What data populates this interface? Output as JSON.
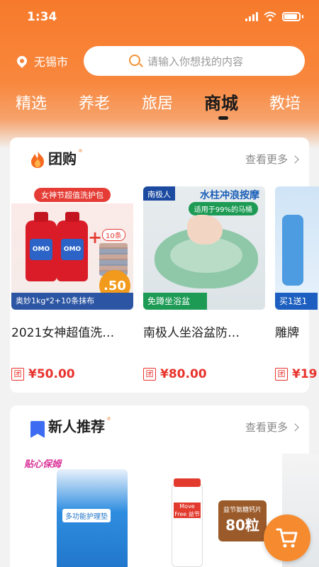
{
  "status_bar": {
    "time": "1:34"
  },
  "header": {
    "location": "无锡市",
    "search_placeholder": "请输入你想找的内容",
    "tabs": [
      {
        "label": "精选",
        "active": false
      },
      {
        "label": "养老",
        "active": false
      },
      {
        "label": "旅居",
        "active": false
      },
      {
        "label": "商城",
        "active": true
      },
      {
        "label": "教培",
        "active": false
      }
    ]
  },
  "group_buy": {
    "title": "团购",
    "more_label": "查看更多",
    "badge_label": "团",
    "products": [
      {
        "name": "2021女神超值洗…",
        "price": "¥50.00",
        "image": {
          "banner": "女神节超值洗护包",
          "count_badge": "10条",
          "price_tag": ".50",
          "caption": "奥妙1kg*2+10条抹布",
          "brand": "OMO"
        }
      },
      {
        "name": "南极人坐浴盆防…",
        "price": "¥80.00",
        "image": {
          "brand": "南极人",
          "headline": "水柱冲浪按摩",
          "sub": "适用于99%的马桶",
          "caption": "免蹲坐浴盆"
        }
      },
      {
        "name": "雕牌 ",
        "price": "¥19",
        "image": {
          "caption": "买1送1"
        }
      }
    ]
  },
  "new_user": {
    "title": "新人推荐",
    "more_label": "查看更多",
    "items": [
      {
        "logo": "贴心保姆",
        "label": "多功能护理垫"
      },
      {
        "label": "Move Free 益节",
        "tag_small": "益节氨糖钙片",
        "tag_big": "80粒"
      },
      {
        "label": ""
      }
    ]
  },
  "colors": {
    "accent": "#f77a2b",
    "price": "#e8332d",
    "bookmark": "#3d6cf2"
  },
  "icons": [
    "location-pin-icon",
    "search-icon",
    "flame-icon",
    "bookmark-icon",
    "chevron-right-icon",
    "cart-icon"
  ]
}
